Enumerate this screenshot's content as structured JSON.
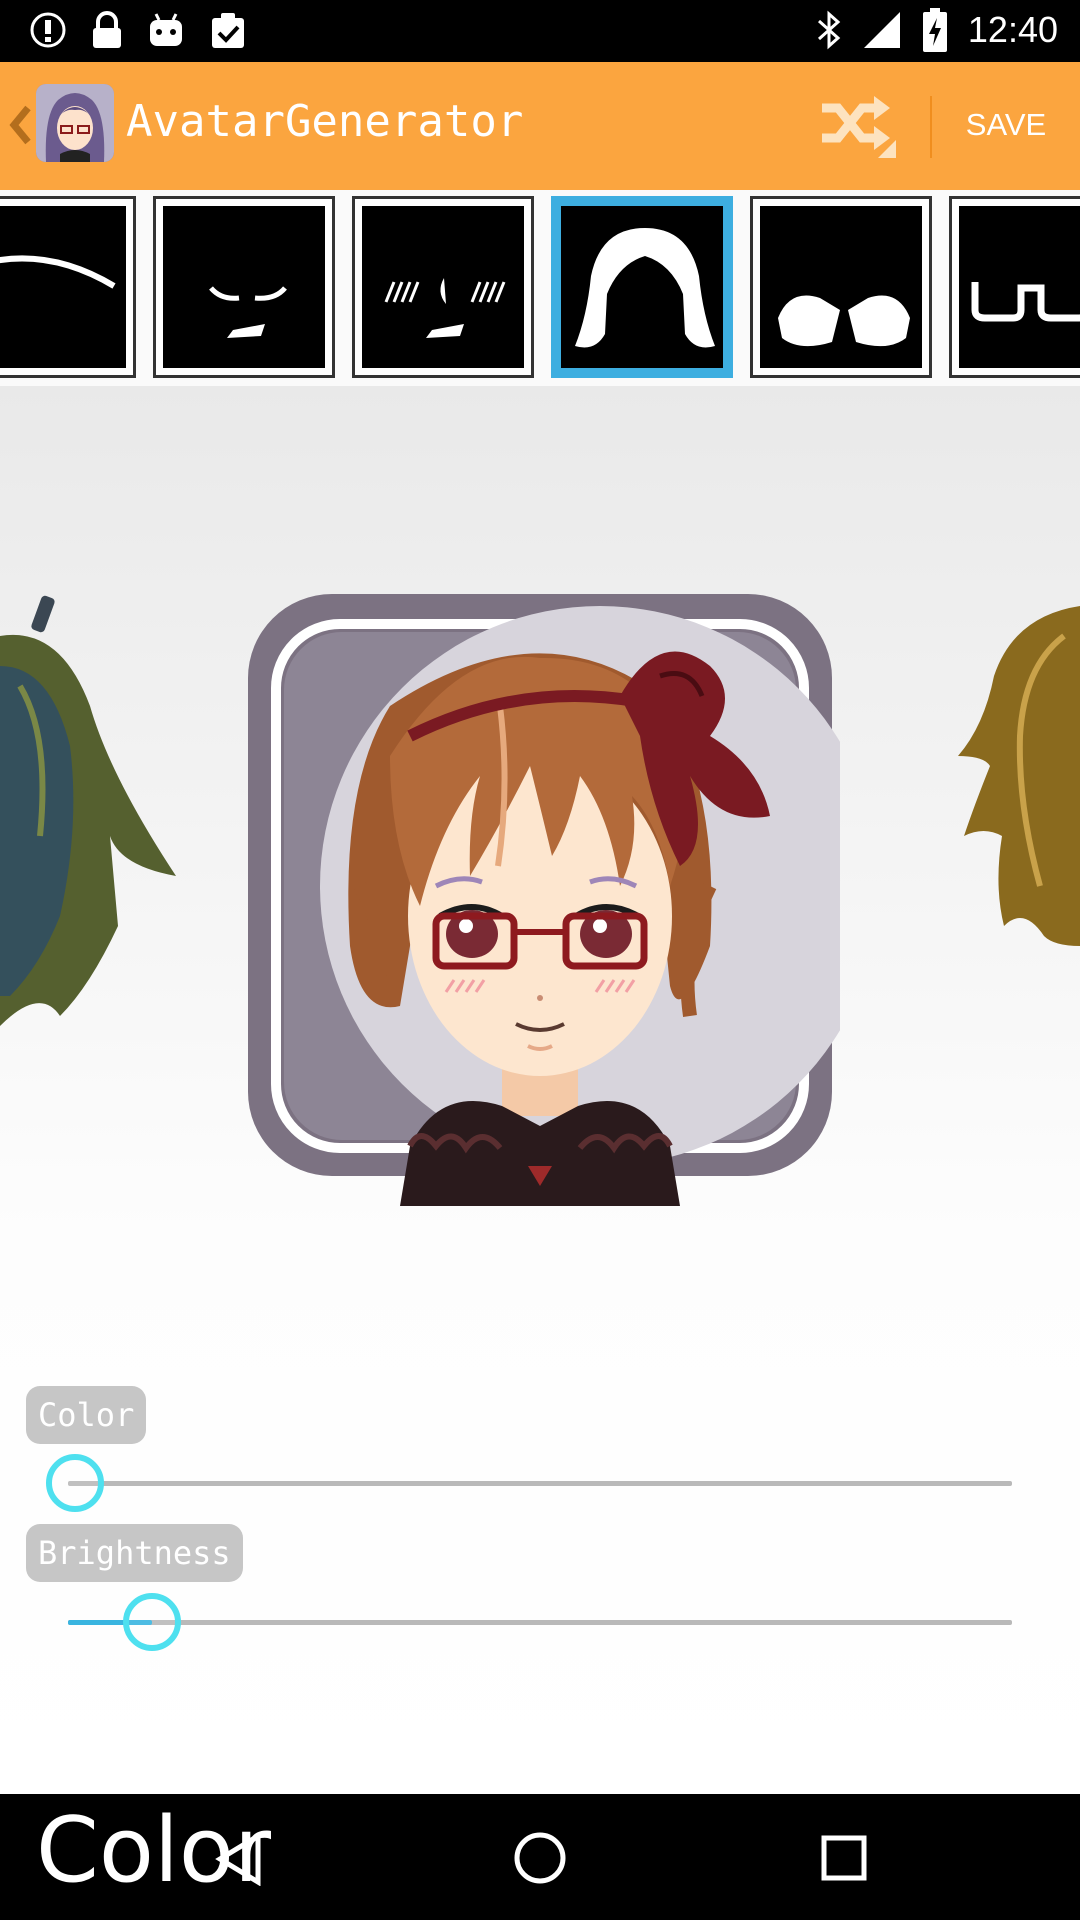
{
  "status_bar": {
    "time": "12:40",
    "icons": [
      "info-icon",
      "lock-icon",
      "android-icon",
      "clipboard-check-icon",
      "bluetooth-icon",
      "signal-icon",
      "battery-charging-icon"
    ]
  },
  "app_bar": {
    "title": "AvatarGenerator",
    "save_label": "SAVE",
    "icons": [
      "back-chevron-icon",
      "app-logo-icon",
      "shuffle-icon"
    ]
  },
  "thumb_strip": {
    "items": [
      {
        "name": "eyebrow-thumb",
        "selected": false
      },
      {
        "name": "face-lower-thumb",
        "selected": false
      },
      {
        "name": "blush-thumb",
        "selected": false
      },
      {
        "name": "hair-thumb",
        "selected": true
      },
      {
        "name": "collar-thumb",
        "selected": false
      },
      {
        "name": "glasses-thumb",
        "selected": false
      }
    ]
  },
  "sliders": {
    "color": {
      "label": "Color",
      "value": 0.0
    },
    "brightness": {
      "label": "Brightness",
      "value": 0.09
    }
  },
  "nav_bar": {
    "overlay_text": "Color",
    "icons": [
      "back-triangle-icon",
      "home-circle-icon",
      "recents-square-icon"
    ]
  },
  "colors": {
    "app_bar": "#fba53f",
    "selected_thumb": "#3daee0",
    "slider_knob": "#4ee0ef",
    "slider_fill": "#3ab5e0"
  }
}
